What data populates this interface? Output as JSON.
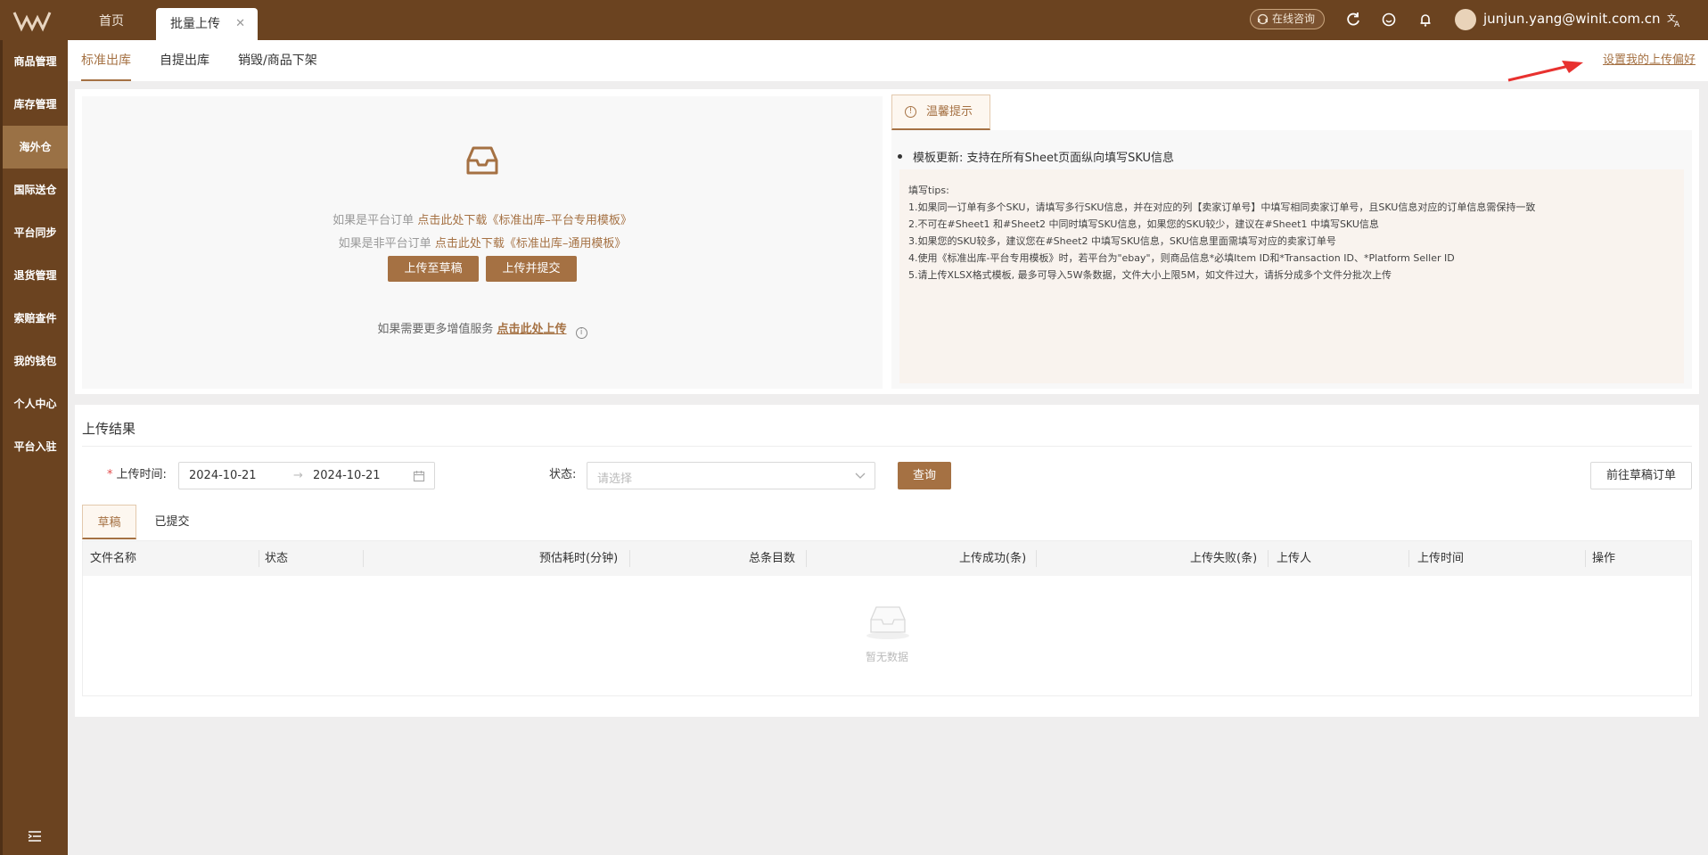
{
  "header": {
    "home_tab": "首页",
    "active_tab": "批量上传",
    "consult_label": "在线咨询",
    "user_email": "junjun.yang@winit.com.cn"
  },
  "sidebar": {
    "items": [
      "商品管理",
      "库存管理",
      "海外仓",
      "国际送仓",
      "平台同步",
      "退货管理",
      "索赔查件",
      "我的钱包",
      "个人中心",
      "平台入驻"
    ],
    "active_index": 2
  },
  "subtabs": [
    "标准出库",
    "自提出库",
    "销毁/商品下架"
  ],
  "pref_link": "设置我的上传偏好",
  "upload": {
    "line1_prefix": "如果是平台订单",
    "line1_link": "点击此处下载《标准出库–平台专用模板》",
    "line2_prefix": "如果是非平台订单",
    "line2_link": "点击此处下载《标准出库–通用模板》",
    "btn_draft": "上传至草稿",
    "btn_submit": "上传并提交",
    "more_prefix": "如果需要更多增值服务",
    "more_link": "点击此处上传"
  },
  "tips": {
    "tab_label": "温馨提示",
    "update": "模板更新: 支持在所有Sheet页面纵向填写SKU信息",
    "title": "填写tips:",
    "lines": [
      "1.如果同一订单有多个SKU，请填写多行SKU信息，并在对应的列【卖家订单号】中填写相同卖家订单号，且SKU信息对应的订单信息需保持一致",
      "2.不可在#Sheet1 和#Sheet2 中同时填写SKU信息，如果您的SKU较少，建议在#Sheet1 中填写SKU信息",
      "3.如果您的SKU较多，建议您在#Sheet2 中填写SKU信息，SKU信息里面需填写对应的卖家订单号",
      "4.使用《标准出库-平台专用模板》时，若平台为\"ebay\"，则商品信息*必填Item ID和*Transaction ID、*Platform Seller ID",
      "5.请上传XLSX格式模板, 最多可导入5W条数据，文件大小上限5M，如文件过大，请拆分成多个文件分批次上传"
    ]
  },
  "results": {
    "title": "上传结果",
    "time_label": "上传时间:",
    "date_from": "2024-10-21",
    "date_to": "2024-10-21",
    "status_label": "状态:",
    "status_placeholder": "请选择",
    "query_btn": "查询",
    "draft_orders_btn": "前往草稿订单",
    "tabs": [
      "草稿",
      "已提交"
    ],
    "columns": [
      "文件名称",
      "状态",
      "预估耗时(分钟)",
      "总条目数",
      "上传成功(条)",
      "上传失败(条)",
      "上传人",
      "上传时间",
      "操作"
    ],
    "empty_text": "暂无数据"
  },
  "colors": {
    "brand": "#6b4320",
    "accent": "#a57143"
  },
  "icons": [
    "logo-icon",
    "close-icon",
    "headset-icon",
    "refresh-icon",
    "smile-icon",
    "bell-icon",
    "translate-icon",
    "inbox-icon",
    "info-icon",
    "calendar-icon",
    "chevron-down-icon",
    "menu-collapse-icon"
  ]
}
